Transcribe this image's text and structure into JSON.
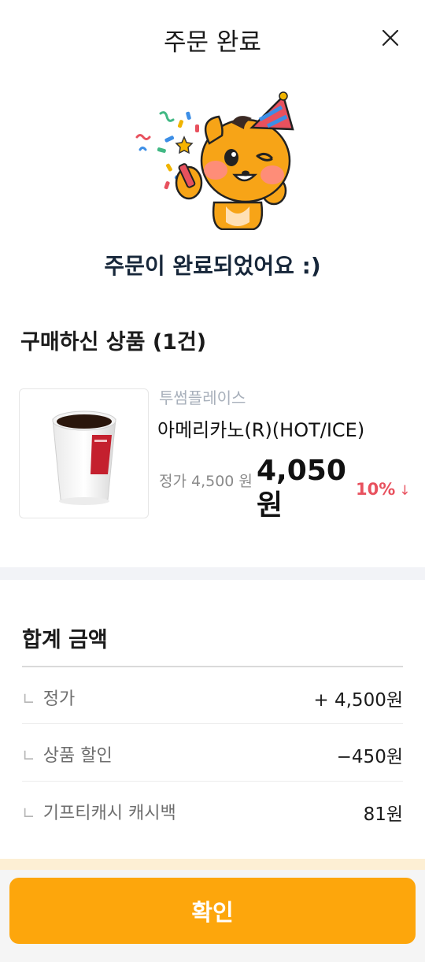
{
  "header": {
    "title": "주문 완료",
    "close_icon": "close-icon"
  },
  "message": "주문이 완료되었어요 :)",
  "purchased": {
    "title": "구매하신 상품 (1건)",
    "item": {
      "store": "투썸플레이스",
      "name": "아메리카노(R)(HOT/ICE)",
      "list_price": "정가 4,500 원",
      "sale_price": "4,050 원",
      "discount": "10%",
      "discount_icon": "down-arrow-icon",
      "thumbnail_icon": "coffee-cup-icon"
    }
  },
  "totals": {
    "title": "합계 금액",
    "rows": [
      {
        "label": "정가",
        "value": "+ 4,500원"
      },
      {
        "label": "상품 할인",
        "value": "−450원"
      },
      {
        "label": "기프티캐시 캐시백",
        "value": "81원"
      }
    ]
  },
  "confirm_button": "확인",
  "colors": {
    "accent": "#fda60c",
    "discount": "#e8515e",
    "heading": "#17273a",
    "band": "#f2f3f7"
  }
}
